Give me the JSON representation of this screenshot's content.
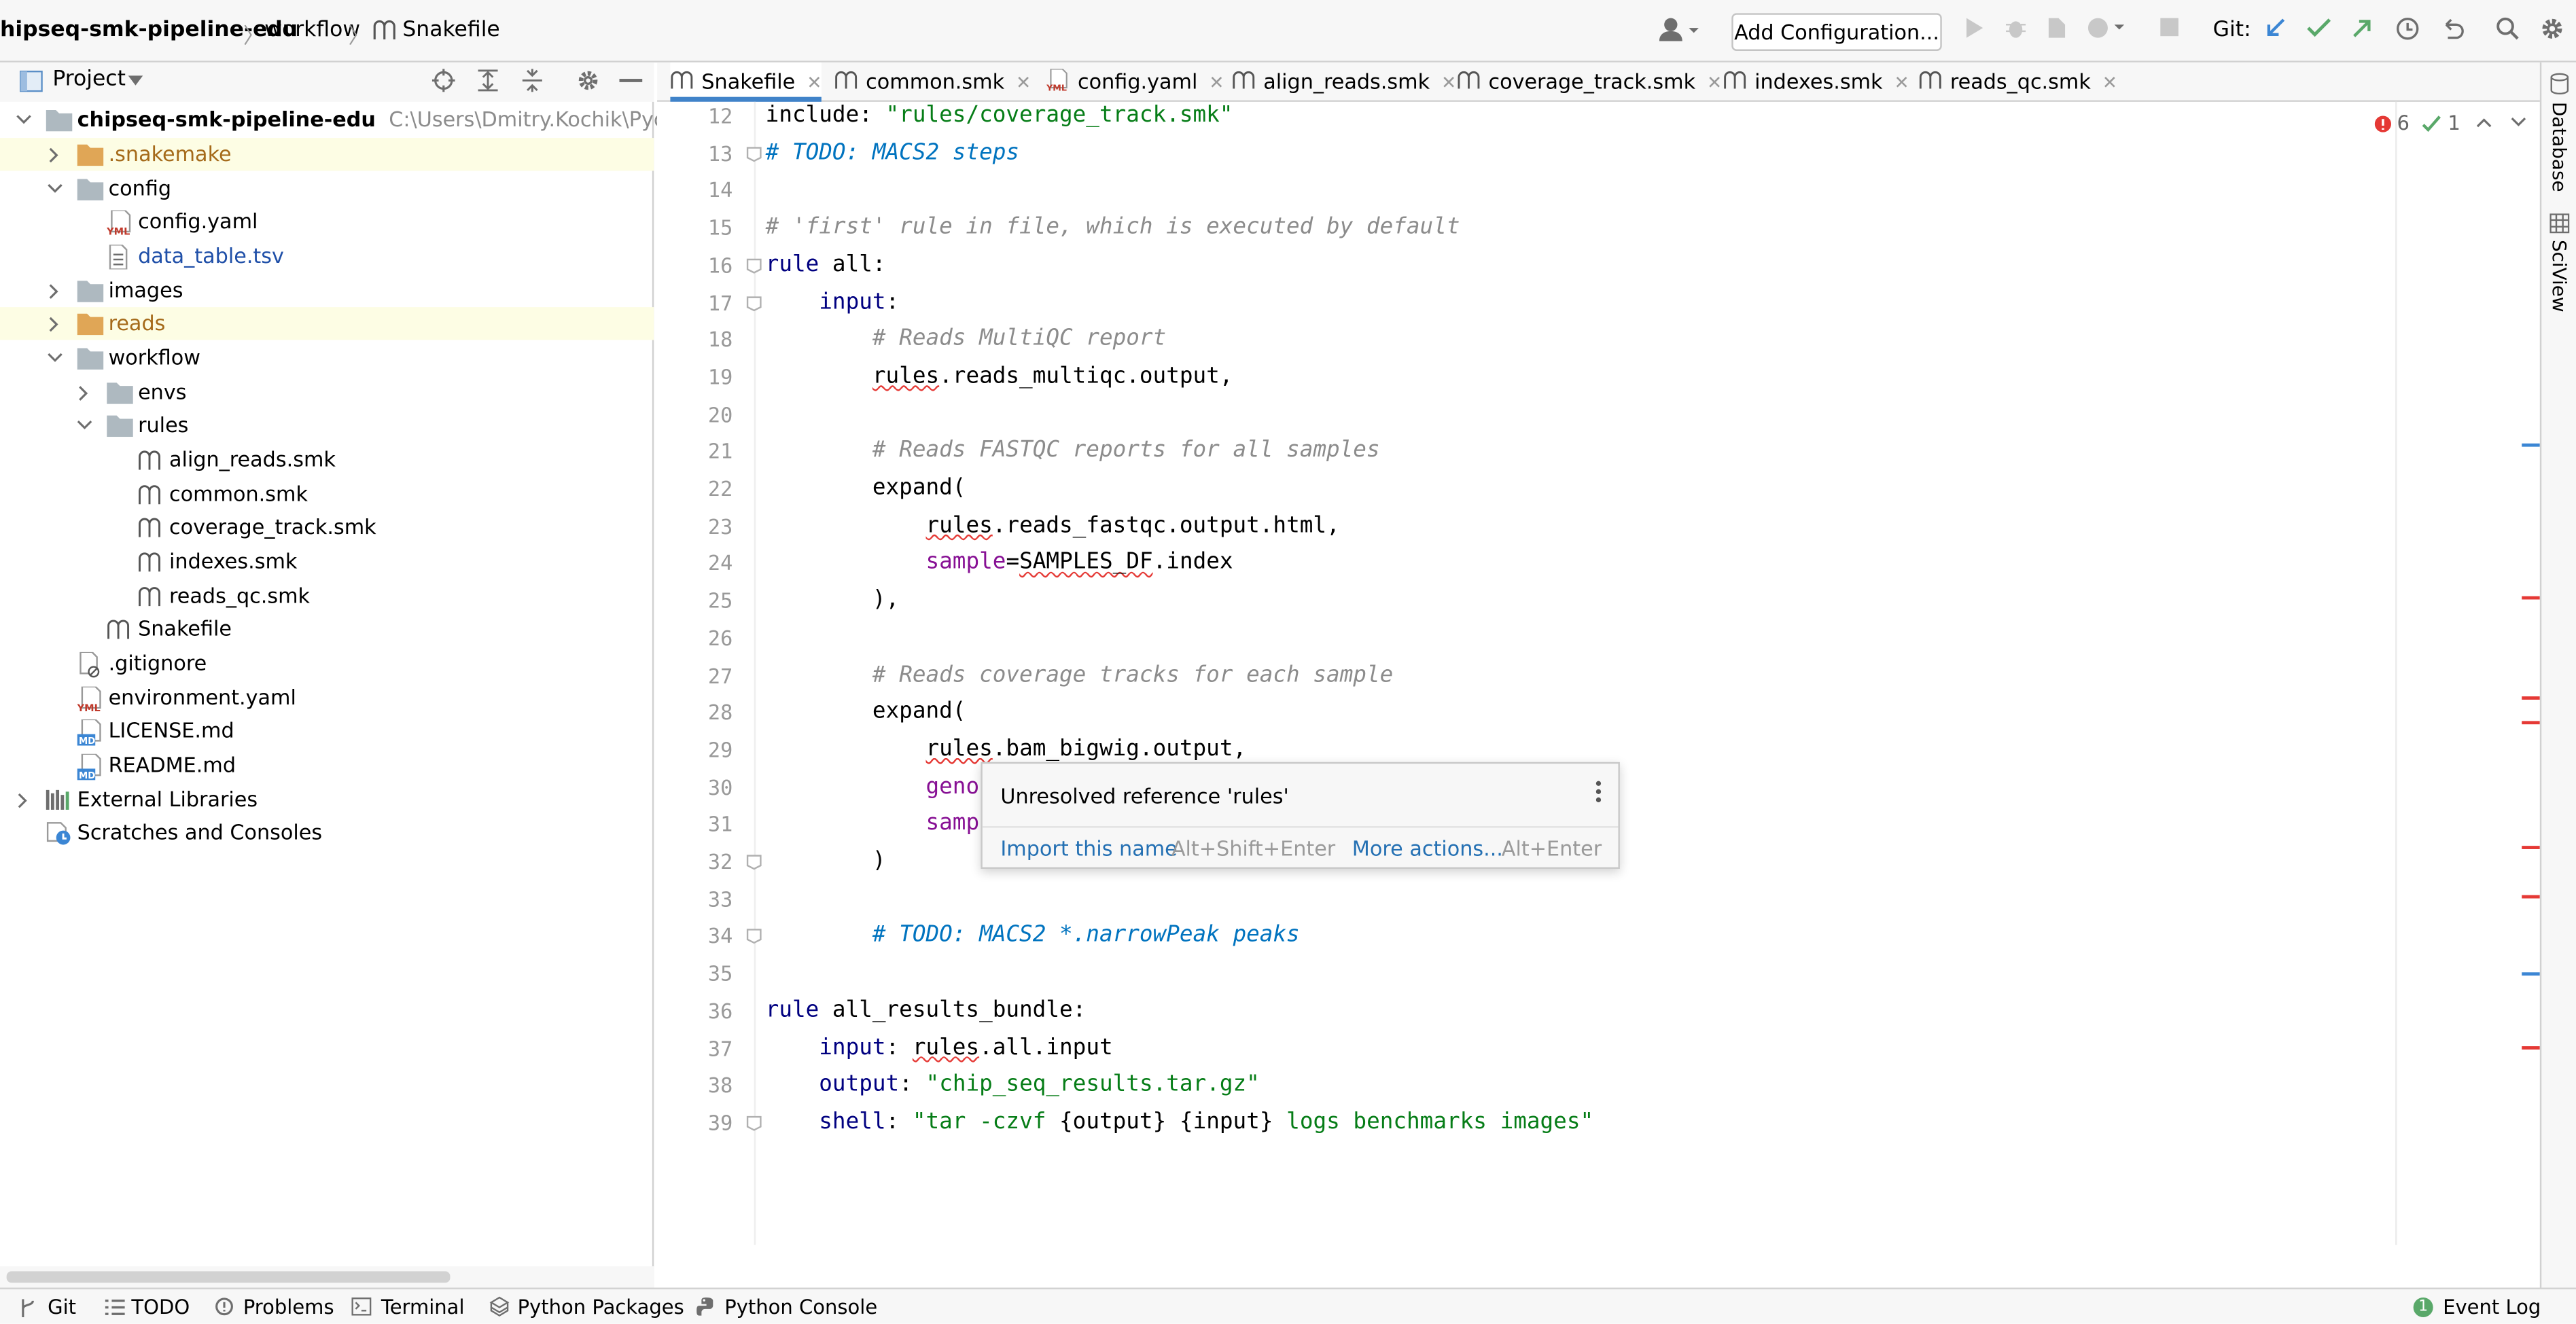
{
  "breadcrumb": {
    "project": "hipseq-smk-pipeline-edu",
    "folder": "workflow",
    "file": "Snakefile",
    "separator": "〉"
  },
  "toolbar": {
    "add_configuration": "Add Configuration...",
    "git_label": "Git:"
  },
  "project_panel": {
    "title": "Project"
  },
  "tree": {
    "root": {
      "name": "chipseq-smk-pipeline-edu",
      "path": "C:\\Users\\Dmitry.Kochik\\PycharmPro"
    },
    "items": [
      {
        "label": ".snakemake"
      },
      {
        "label": "config"
      },
      {
        "label": "config.yaml"
      },
      {
        "label": "data_table.tsv"
      },
      {
        "label": "images"
      },
      {
        "label": "reads"
      },
      {
        "label": "workflow"
      },
      {
        "label": "envs"
      },
      {
        "label": "rules"
      },
      {
        "label": "align_reads.smk"
      },
      {
        "label": "common.smk"
      },
      {
        "label": "coverage_track.smk"
      },
      {
        "label": "indexes.smk"
      },
      {
        "label": "reads_qc.smk"
      },
      {
        "label": "Snakefile"
      },
      {
        "label": ".gitignore"
      },
      {
        "label": "environment.yaml"
      },
      {
        "label": "LICENSE.md"
      },
      {
        "label": "README.md"
      },
      {
        "label": "External Libraries"
      },
      {
        "label": "Scratches and Consoles"
      }
    ]
  },
  "tabs": [
    "Snakefile",
    "common.smk",
    "config.yaml",
    "align_reads.smk",
    "coverage_track.smk",
    "indexes.smk",
    "reads_qc.smk"
  ],
  "inspections": {
    "errors": "6",
    "warnings": "1"
  },
  "editor": {
    "lines": [
      {
        "n": "12",
        "segs": [
          [
            "",
            "include: "
          ],
          [
            "str",
            "\"rules/coverage_track.smk\""
          ]
        ]
      },
      {
        "n": "13",
        "segs": [
          [
            "todo",
            "# TODO: MACS2 steps"
          ]
        ]
      },
      {
        "n": "14",
        "segs": []
      },
      {
        "n": "15",
        "segs": [
          [
            "cm",
            "# 'first' rule in file, which is executed by default"
          ]
        ]
      },
      {
        "n": "16",
        "segs": [
          [
            "kw",
            "rule"
          ],
          [
            "",
            " all:"
          ]
        ]
      },
      {
        "n": "17",
        "segs": [
          [
            "",
            "    "
          ],
          [
            "kw",
            "input"
          ],
          [
            "",
            ":"
          ]
        ]
      },
      {
        "n": "18",
        "segs": [
          [
            "",
            "        "
          ],
          [
            "cm",
            "# Reads MultiQC report"
          ]
        ]
      },
      {
        "n": "19",
        "segs": [
          [
            "",
            "        "
          ],
          [
            "err",
            "rules"
          ],
          [
            "",
            ".reads_multiqc.output,"
          ]
        ]
      },
      {
        "n": "20",
        "segs": []
      },
      {
        "n": "21",
        "segs": [
          [
            "",
            "        "
          ],
          [
            "cm",
            "# Reads FASTQC reports for all samples"
          ]
        ]
      },
      {
        "n": "22",
        "segs": [
          [
            "",
            "        expand("
          ]
        ]
      },
      {
        "n": "23",
        "segs": [
          [
            "",
            "            "
          ],
          [
            "err",
            "rules"
          ],
          [
            "",
            ".reads_fastqc.output.html,"
          ]
        ]
      },
      {
        "n": "24",
        "segs": [
          [
            "",
            "            "
          ],
          [
            "par",
            "sample"
          ],
          [
            "",
            "="
          ],
          [
            "err",
            "SAMPLES_DF"
          ],
          [
            "",
            ".index"
          ]
        ]
      },
      {
        "n": "25",
        "segs": [
          [
            "",
            "        ),"
          ]
        ]
      },
      {
        "n": "26",
        "segs": []
      },
      {
        "n": "27",
        "segs": [
          [
            "",
            "        "
          ],
          [
            "cm",
            "# Reads coverage tracks for each sample"
          ]
        ]
      },
      {
        "n": "28",
        "segs": [
          [
            "",
            "        expand("
          ]
        ]
      },
      {
        "n": "29",
        "segs": [
          [
            "",
            "            "
          ],
          [
            "err",
            "rules"
          ],
          [
            "",
            ".bam_bigwig.output,"
          ]
        ]
      },
      {
        "n": "30",
        "segs": [
          [
            "",
            "            "
          ],
          [
            "par",
            "geno"
          ]
        ]
      },
      {
        "n": "31",
        "segs": [
          [
            "",
            "            "
          ],
          [
            "par",
            "samp"
          ]
        ]
      },
      {
        "n": "32",
        "segs": [
          [
            "",
            "        )"
          ]
        ]
      },
      {
        "n": "33",
        "segs": []
      },
      {
        "n": "34",
        "segs": [
          [
            "",
            "        "
          ],
          [
            "todo",
            "# TODO: MACS2 *.narrowPeak peaks"
          ]
        ]
      },
      {
        "n": "35",
        "segs": []
      },
      {
        "n": "36",
        "segs": [
          [
            "kw",
            "rule"
          ],
          [
            "",
            " all_results_bundle:"
          ]
        ]
      },
      {
        "n": "37",
        "segs": [
          [
            "",
            "    "
          ],
          [
            "kw",
            "input"
          ],
          [
            ": "
          ],
          [
            "err",
            "rules"
          ],
          [
            "",
            ".all.input"
          ]
        ]
      },
      {
        "n": "38",
        "segs": [
          [
            "",
            "    "
          ],
          [
            "kw",
            "output"
          ],
          [
            "",
            ": "
          ],
          [
            "str",
            "\"chip_seq_results.tar.gz\""
          ]
        ]
      },
      {
        "n": "39",
        "segs": [
          [
            "",
            "    "
          ],
          [
            "kw",
            "shell"
          ],
          [
            "",
            ": "
          ],
          [
            "str",
            "\"tar -czvf "
          ],
          [
            "",
            "{output}"
          ],
          [
            "str",
            " "
          ],
          [
            "",
            "{input}"
          ],
          [
            "str",
            " logs benchmarks images\""
          ]
        ]
      }
    ]
  },
  "popup": {
    "message": "Unresolved reference 'rules'",
    "action1": "Import this name",
    "shortcut1": "Alt+Shift+Enter",
    "action2": "More actions...",
    "shortcut2": "Alt+Enter"
  },
  "right_strip": {
    "database": "Database",
    "sciview": "SciView"
  },
  "statusbar": {
    "git": "Git",
    "todo": "TODO",
    "problems": "Problems",
    "terminal": "Terminal",
    "python_packages": "Python Packages",
    "python_console": "Python Console",
    "event_log": "Event Log",
    "event_count": "1"
  },
  "colors": {
    "accent": "#4083c9",
    "error": "#e53935",
    "success": "#59a869",
    "folder": "#aeb9c0",
    "excluded_folder": "#e0a656"
  }
}
